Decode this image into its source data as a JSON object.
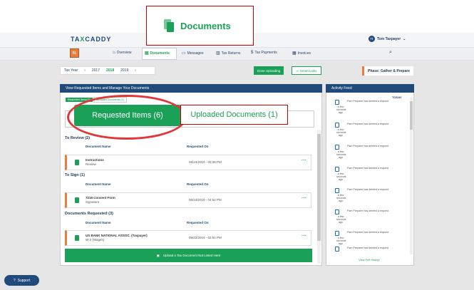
{
  "app": {
    "logo_pre": "TA",
    "logo_x": "X",
    "logo_post": "CADDY",
    "user": "Tom Taxpayer",
    "user_initials": "TT",
    "firm_initials": "BL"
  },
  "nav": {
    "overview": "Overview",
    "documents": "Documents",
    "messages": "Messages",
    "tax_returns": "Tax Returns",
    "tax_payments": "Tax Payments",
    "invoices": "Invoices"
  },
  "tax_year": {
    "label": "Tax Year",
    "years": [
      "2017",
      "2018",
      "2019"
    ],
    "selected": "2018"
  },
  "buttons": {
    "done_uploading": "Done Uploading",
    "smart_links": "Smart Links"
  },
  "phase": "Phase: Gather & Prepare",
  "panel": {
    "title": "View Requested Items and Manage Your Documents",
    "small_tabs": [
      "Requested Items (6)",
      "Uploaded Documents (1)"
    ],
    "tab_requested": "Requested Items (6)",
    "tab_uploaded": "Uploaded Documents (1)",
    "col_name": "Document Name",
    "col_date": "Requested On",
    "to_review": {
      "heading": "To Review (2)",
      "items": [
        {
          "name": "Instructions",
          "sub": "Review",
          "date": "06/24/2019 - 03:36 PM"
        }
      ]
    },
    "to_sign": {
      "heading": "To Sign (1)",
      "items": [
        {
          "name": "7216 Consent Form",
          "sub": "Signature",
          "date": "06/24/2019 - 04:52 PM"
        }
      ]
    },
    "docs_requested": {
      "heading": "Documents Requested (3)",
      "items": [
        {
          "name": "US BANK NATIONAL ASSOC. (Taxpayer)",
          "sub": "W-2 (Wages)",
          "date": "05/22/2019 - 02:51 PM"
        }
      ]
    },
    "upload_button": "Upload a Tax Document Not Listed Here"
  },
  "feed": {
    "title": "Activity Feed",
    "today": "TODAY",
    "message": "Pam Preparer has deleted a request.",
    "age": "a few seconds ago",
    "view_history": "View Full History"
  },
  "callout": {
    "label": "Documents"
  },
  "support": "Support",
  "colors": {
    "green": "#1ba157",
    "navy": "#1f4a7a",
    "orange": "#e87d3e",
    "red": "#e0373a"
  }
}
